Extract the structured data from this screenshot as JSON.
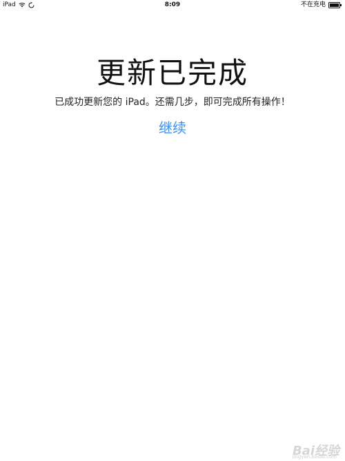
{
  "status_bar": {
    "device": "iPad",
    "time": "8:09",
    "charging": "不在充电",
    "icons": [
      "wifi-icon",
      "sync-icon",
      "battery-icon"
    ]
  },
  "main": {
    "title": "更新已完成",
    "subtitle": "已成功更新您的 iPad。还需几步，即可完成所有操作！",
    "continue_label": "继续"
  },
  "watermark": {
    "text": "Bai经验",
    "sub": "jingyan.baidu.com"
  },
  "colors": {
    "link": "#3a8ff7",
    "text": "#111111",
    "background": "#ffffff"
  }
}
